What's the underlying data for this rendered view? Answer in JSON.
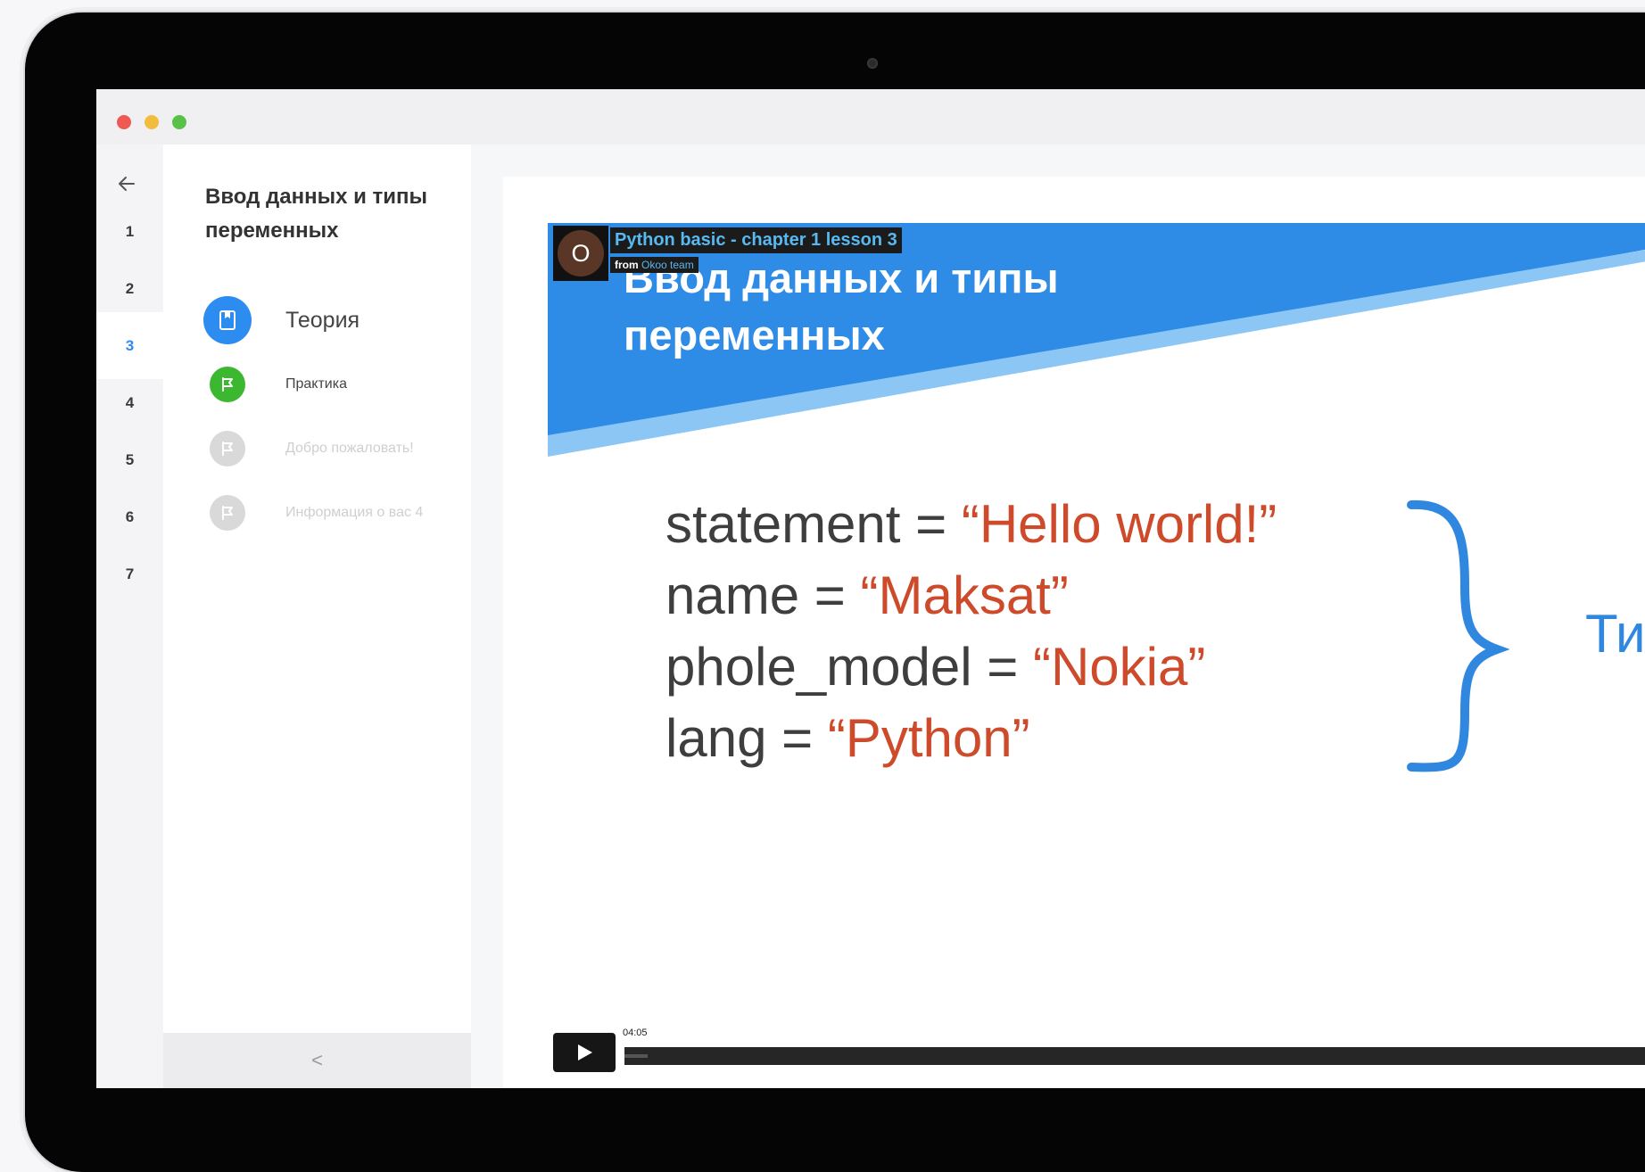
{
  "window": {
    "controls": [
      "close",
      "minimize",
      "zoom"
    ],
    "colors": {
      "close": "#ee5a52",
      "minimize": "#f2bd3f",
      "zoom": "#5ac148"
    }
  },
  "nav": {
    "back_icon": "arrow-left-icon",
    "steps": [
      "1",
      "2",
      "3",
      "4",
      "5",
      "6",
      "7"
    ],
    "active_step": "3",
    "accent": "#2d8cf0"
  },
  "lesson": {
    "title": "Ввод данных и типы переменных",
    "items": [
      {
        "label": "Теория",
        "icon": "book-icon",
        "state": "active",
        "color": "#2d8cf0"
      },
      {
        "label": "Практика",
        "icon": "flag-icon",
        "state": "done",
        "color": "#3bb82f"
      },
      {
        "label": "Добро пожаловать!",
        "icon": "flag-icon",
        "state": "locked",
        "color": "#d6d6d6"
      },
      {
        "label": "Информация о вас 4",
        "icon": "flag-icon",
        "state": "locked",
        "color": "#d6d6d6"
      }
    ],
    "collapse_label": "<"
  },
  "video": {
    "title": "Python basic - chapter 1 lesson 3",
    "from_label": "from",
    "author": "Okoo team",
    "avatar_letter": "O",
    "time": "04:05",
    "progress": 0.02
  },
  "slide": {
    "title": "Ввод данных и типы переменных",
    "code": [
      {
        "var": "statement",
        "value": "“Hello world!”"
      },
      {
        "var": "name",
        "value": "“Maksat”"
      },
      {
        "var": "phole_model",
        "value": "“Nokia”"
      },
      {
        "var": "lang",
        "value": "“Python”"
      }
    ],
    "operator": "=",
    "brace_label": "Тип",
    "colors": {
      "header": "#2e8be6",
      "string": "#cd4b2a",
      "text": "#3e3e3e"
    }
  }
}
